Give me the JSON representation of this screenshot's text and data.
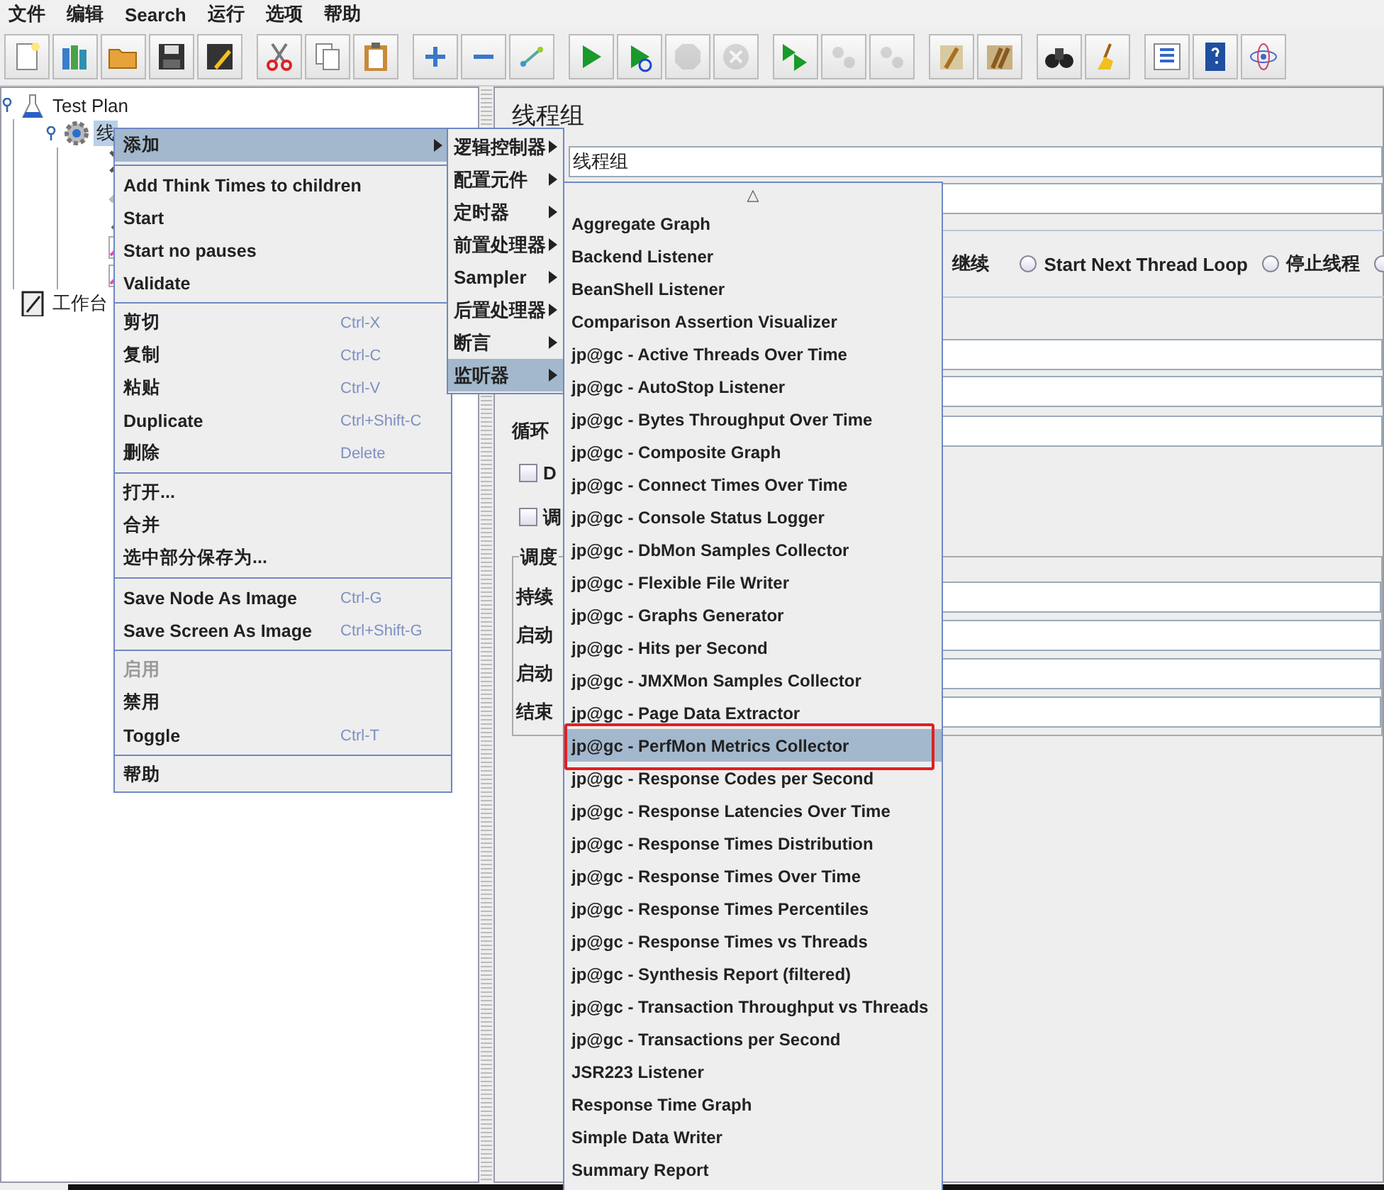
{
  "menubar": [
    {
      "label": "文件"
    },
    {
      "label": "编辑"
    },
    {
      "label": "Search"
    },
    {
      "label": "运行"
    },
    {
      "label": "选项"
    },
    {
      "label": "帮助"
    }
  ],
  "toolbar": {
    "groups": [
      [
        {
          "disabled": false
        },
        {
          "disabled": false
        },
        {
          "disabled": false
        },
        {
          "disabled": false
        },
        {
          "disabled": false
        }
      ],
      [
        {
          "disabled": false
        },
        {
          "disabled": false
        },
        {
          "disabled": false
        }
      ],
      [
        {
          "disabled": false
        },
        {
          "disabled": false
        },
        {
          "disabled": false
        }
      ],
      [
        {
          "disabled": false
        },
        {
          "disabled": false
        },
        {
          "disabled": true
        },
        {
          "disabled": true
        }
      ],
      [
        {
          "disabled": false
        },
        {
          "disabled": true
        },
        {
          "disabled": true
        }
      ],
      [
        {
          "disabled": false
        },
        {
          "disabled": false
        }
      ],
      [
        {
          "disabled": false
        },
        {
          "disabled": false
        }
      ],
      [
        {
          "disabled": false
        },
        {
          "disabled": false
        },
        {
          "disabled": false
        }
      ]
    ]
  },
  "tree": [
    {
      "kind": "plan",
      "label": "Test Plan",
      "selected": false,
      "expanded": true,
      "children": [
        {
          "kind": "thread_group",
          "label": "线",
          "selected": true,
          "expanded": true,
          "children": [
            {
              "kind": "config"
            },
            {
              "kind": "sampler"
            },
            {
              "kind": "extractor"
            },
            {
              "kind": "listener"
            },
            {
              "kind": "listener"
            }
          ]
        }
      ]
    },
    {
      "kind": "workbench",
      "label": "工作台",
      "selected": false
    }
  ],
  "panel": {
    "title": "线程组",
    "name_value": "线程组",
    "on_error": {
      "continue_label": "继续",
      "options": [
        {
          "label": "Start Next Thread Loop",
          "selected": false
        },
        {
          "label": "停止线程",
          "selected": false
        },
        {
          "selected": false
        }
      ]
    },
    "rows": [
      {
        "kind": "field"
      },
      {
        "kind": "field"
      },
      {
        "kind": "field",
        "label": "循环"
      },
      {
        "kind": "checkbox",
        "label": "D",
        "checked": false
      },
      {
        "kind": "checkbox",
        "label": "调",
        "checked": false
      }
    ],
    "scheduler": {
      "title": "调度",
      "fields": [
        {
          "label": "持续"
        },
        {
          "label": "启动"
        },
        {
          "label": "启动"
        },
        {
          "label": "结束"
        }
      ]
    }
  },
  "context_menu": {
    "sections": [
      [
        {
          "label": "添加",
          "submenu": true,
          "selected": true,
          "disabled": false
        }
      ],
      [
        {
          "label": "Add Think Times to children",
          "selected": false,
          "disabled": false
        },
        {
          "label": "Start",
          "selected": false,
          "disabled": false
        },
        {
          "label": "Start no pauses",
          "selected": false,
          "disabled": false
        },
        {
          "label": "Validate",
          "selected": false,
          "disabled": false
        }
      ],
      [
        {
          "label": "剪切",
          "shortcut": "Ctrl-X",
          "selected": false,
          "disabled": false
        },
        {
          "label": "复制",
          "shortcut": "Ctrl-C",
          "selected": false,
          "disabled": false
        },
        {
          "label": "粘贴",
          "shortcut": "Ctrl-V",
          "selected": false,
          "disabled": false
        },
        {
          "label": "Duplicate",
          "shortcut": "Ctrl+Shift-C",
          "selected": false,
          "disabled": false
        },
        {
          "label": "删除",
          "shortcut": "Delete",
          "selected": false,
          "disabled": false
        }
      ],
      [
        {
          "label": "打开...",
          "selected": false,
          "disabled": false
        },
        {
          "label": "合并",
          "selected": false,
          "disabled": false
        },
        {
          "label": "选中部分保存为...",
          "selected": false,
          "disabled": false
        }
      ],
      [
        {
          "label": "Save Node As Image",
          "shortcut": "Ctrl-G",
          "selected": false,
          "disabled": false
        },
        {
          "label": "Save Screen As Image",
          "shortcut": "Ctrl+Shift-G",
          "selected": false,
          "disabled": false
        }
      ],
      [
        {
          "label": "启用",
          "selected": false,
          "disabled": true
        },
        {
          "label": "禁用",
          "selected": false,
          "disabled": false
        },
        {
          "label": "Toggle",
          "shortcut": "Ctrl-T",
          "selected": false,
          "disabled": false
        }
      ],
      [
        {
          "label": "帮助",
          "selected": false,
          "disabled": false
        }
      ]
    ]
  },
  "add_menu": {
    "items": [
      {
        "label": "逻辑控制器",
        "selected": false
      },
      {
        "label": "配置元件",
        "selected": false
      },
      {
        "label": "定时器",
        "selected": false
      },
      {
        "label": "前置处理器",
        "selected": false
      },
      {
        "label": "Sampler",
        "selected": false
      },
      {
        "label": "后置处理器",
        "selected": false
      },
      {
        "label": "断言",
        "selected": false
      },
      {
        "label": "监听器",
        "selected": true
      }
    ]
  },
  "listener_menu": {
    "scroll_up": "△",
    "items": [
      {
        "label": "Aggregate Graph",
        "selected": false
      },
      {
        "label": "Backend Listener",
        "selected": false
      },
      {
        "label": "BeanShell Listener",
        "selected": false
      },
      {
        "label": "Comparison Assertion Visualizer",
        "selected": false
      },
      {
        "label": "jp@gc - Active Threads Over Time",
        "selected": false
      },
      {
        "label": "jp@gc - AutoStop Listener",
        "selected": false
      },
      {
        "label": "jp@gc - Bytes Throughput Over Time",
        "selected": false
      },
      {
        "label": "jp@gc - Composite Graph",
        "selected": false
      },
      {
        "label": "jp@gc - Connect Times Over Time",
        "selected": false
      },
      {
        "label": "jp@gc - Console Status Logger",
        "selected": false
      },
      {
        "label": "jp@gc - DbMon Samples Collector",
        "selected": false
      },
      {
        "label": "jp@gc - Flexible File Writer",
        "selected": false
      },
      {
        "label": "jp@gc - Graphs Generator",
        "selected": false
      },
      {
        "label": "jp@gc - Hits per Second",
        "selected": false
      },
      {
        "label": "jp@gc - JMXMon Samples Collector",
        "selected": false
      },
      {
        "label": "jp@gc - Page Data Extractor",
        "selected": false
      },
      {
        "label": "jp@gc - PerfMon Metrics Collector",
        "selected": true,
        "marked": true
      },
      {
        "label": "jp@gc - Response Codes per Second",
        "selected": false
      },
      {
        "label": "jp@gc - Response Latencies Over Time",
        "selected": false
      },
      {
        "label": "jp@gc - Response Times Distribution",
        "selected": false
      },
      {
        "label": "jp@gc - Response Times Over Time",
        "selected": false
      },
      {
        "label": "jp@gc - Response Times Percentiles",
        "selected": false
      },
      {
        "label": "jp@gc - Response Times vs Threads",
        "selected": false
      },
      {
        "label": "jp@gc - Synthesis Report (filtered)",
        "selected": false
      },
      {
        "label": "jp@gc - Transaction Throughput vs Threads",
        "selected": false
      },
      {
        "label": "jp@gc - Transactions per Second",
        "selected": false
      },
      {
        "label": "JSR223 Listener",
        "selected": false
      },
      {
        "label": "Response Time Graph",
        "selected": false
      },
      {
        "label": "Simple Data Writer",
        "selected": false
      },
      {
        "label": "Summary Report",
        "selected": false
      }
    ]
  }
}
